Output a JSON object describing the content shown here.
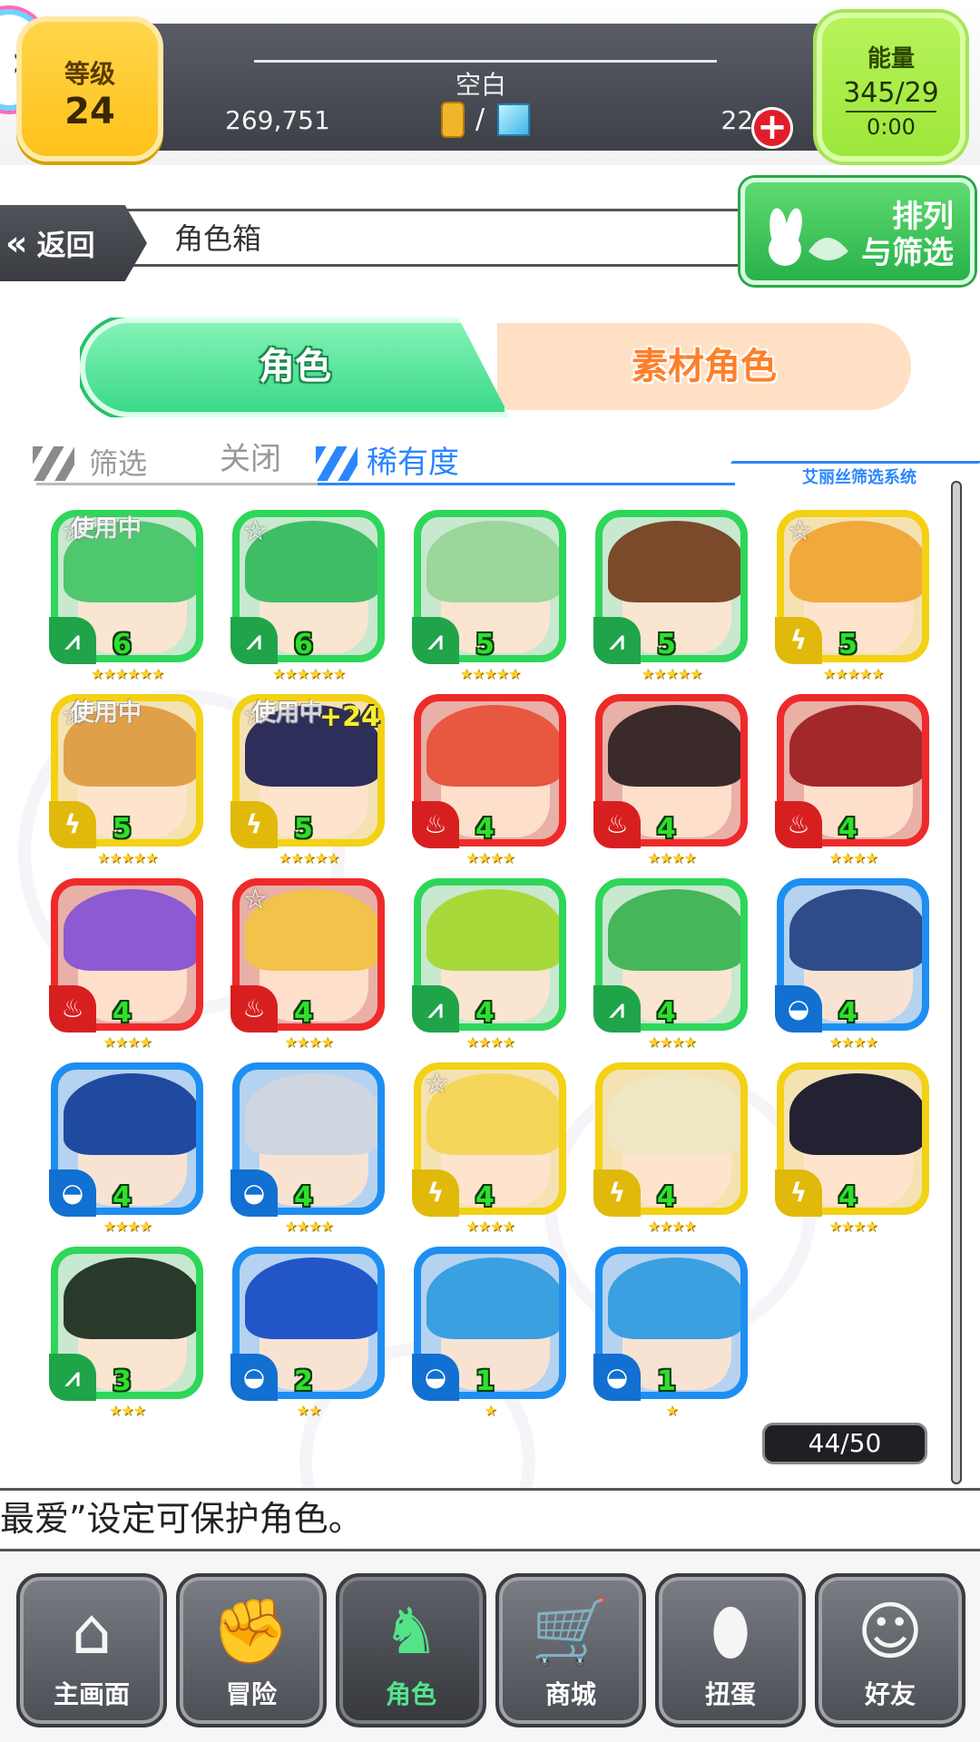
{
  "top": {
    "level_label": "等级",
    "level_value": "24",
    "player_name": "空白",
    "gold": "269,751",
    "gems": "220",
    "currency_separator": "/",
    "energy_label": "能量",
    "energy_value": "345/29",
    "energy_timer": "0:00"
  },
  "header": {
    "back_label": "返回",
    "title": "角色箱",
    "sort_label_1": "排列",
    "sort_label_2": "与筛选"
  },
  "tabs": {
    "characters": "角色",
    "materials": "素材角色"
  },
  "filter": {
    "filter_label": "筛选",
    "filter_value": "关闭",
    "rarity_label": "稀有度",
    "system_label": "艾丽丝筛选系统"
  },
  "cards": [
    {
      "element": "green",
      "level": "6",
      "stars": "★★★★★★",
      "fav": true,
      "in_use": "使用中",
      "plus": ""
    },
    {
      "element": "green",
      "level": "6",
      "stars": "★★★★★★",
      "fav": true,
      "in_use": "",
      "plus": ""
    },
    {
      "element": "green",
      "level": "5",
      "stars": "★★★★★",
      "fav": false,
      "in_use": "",
      "plus": ""
    },
    {
      "element": "green",
      "level": "5",
      "stars": "★★★★★",
      "fav": false,
      "in_use": "",
      "plus": ""
    },
    {
      "element": "yellow",
      "level": "5",
      "stars": "★★★★★",
      "fav": true,
      "in_use": "",
      "plus": ""
    },
    {
      "element": "yellow",
      "level": "5",
      "stars": "★★★★★",
      "fav": true,
      "in_use": "使用中",
      "plus": ""
    },
    {
      "element": "yellow",
      "level": "5",
      "stars": "★★★★★",
      "fav": true,
      "in_use": "使用中",
      "plus": "+24"
    },
    {
      "element": "red",
      "level": "4",
      "stars": "★★★★",
      "fav": false,
      "in_use": "",
      "plus": ""
    },
    {
      "element": "red",
      "level": "4",
      "stars": "★★★★",
      "fav": false,
      "in_use": "",
      "plus": ""
    },
    {
      "element": "red",
      "level": "4",
      "stars": "★★★★",
      "fav": false,
      "in_use": "",
      "plus": ""
    },
    {
      "element": "red",
      "level": "4",
      "stars": "★★★★",
      "fav": false,
      "in_use": "",
      "plus": ""
    },
    {
      "element": "red",
      "level": "4",
      "stars": "★★★★",
      "fav": true,
      "in_use": "",
      "plus": ""
    },
    {
      "element": "green",
      "level": "4",
      "stars": "★★★★",
      "fav": false,
      "in_use": "",
      "plus": ""
    },
    {
      "element": "green",
      "level": "4",
      "stars": "★★★★",
      "fav": false,
      "in_use": "",
      "plus": ""
    },
    {
      "element": "blue",
      "level": "4",
      "stars": "★★★★",
      "fav": false,
      "in_use": "",
      "plus": ""
    },
    {
      "element": "blue",
      "level": "4",
      "stars": "★★★★",
      "fav": false,
      "in_use": "",
      "plus": ""
    },
    {
      "element": "blue",
      "level": "4",
      "stars": "★★★★",
      "fav": false,
      "in_use": "",
      "plus": ""
    },
    {
      "element": "yellow",
      "level": "4",
      "stars": "★★★★",
      "fav": true,
      "in_use": "",
      "plus": ""
    },
    {
      "element": "yellow",
      "level": "4",
      "stars": "★★★★",
      "fav": false,
      "in_use": "",
      "plus": ""
    },
    {
      "element": "yellow",
      "level": "4",
      "stars": "★★★★",
      "fav": false,
      "in_use": "",
      "plus": ""
    },
    {
      "element": "green",
      "level": "3",
      "stars": "★★★",
      "fav": false,
      "in_use": "",
      "plus": ""
    },
    {
      "element": "blue",
      "level": "2",
      "stars": "★★",
      "fav": false,
      "in_use": "",
      "plus": ""
    },
    {
      "element": "blue",
      "level": "1",
      "stars": "★",
      "fav": false,
      "in_use": "",
      "plus": ""
    },
    {
      "element": "blue",
      "level": "1",
      "stars": "★",
      "fav": false,
      "in_use": "",
      "plus": ""
    }
  ],
  "element_icons": {
    "green": "wind-icon",
    "yellow": "thunder-icon",
    "red": "fire-icon",
    "blue": "water-icon"
  },
  "element_glyphs": {
    "green": "⩘",
    "yellow": "ϟ",
    "red": "♨",
    "blue": "◒"
  },
  "count": "44/50",
  "message": "最爱”设定可保护角色。",
  "nav": [
    {
      "label": "主画面",
      "icon": "home-icon",
      "glyph": "⌂"
    },
    {
      "label": "冒险",
      "icon": "handshake-icon",
      "glyph": "✊"
    },
    {
      "label": "角色",
      "icon": "rabbit-icon",
      "glyph": "♞"
    },
    {
      "label": "商城",
      "icon": "cart-icon",
      "glyph": "🛒"
    },
    {
      "label": "扭蛋",
      "icon": "egg-icon",
      "glyph": "⬮"
    },
    {
      "label": "好友",
      "icon": "friends-icon",
      "glyph": "☺"
    }
  ]
}
